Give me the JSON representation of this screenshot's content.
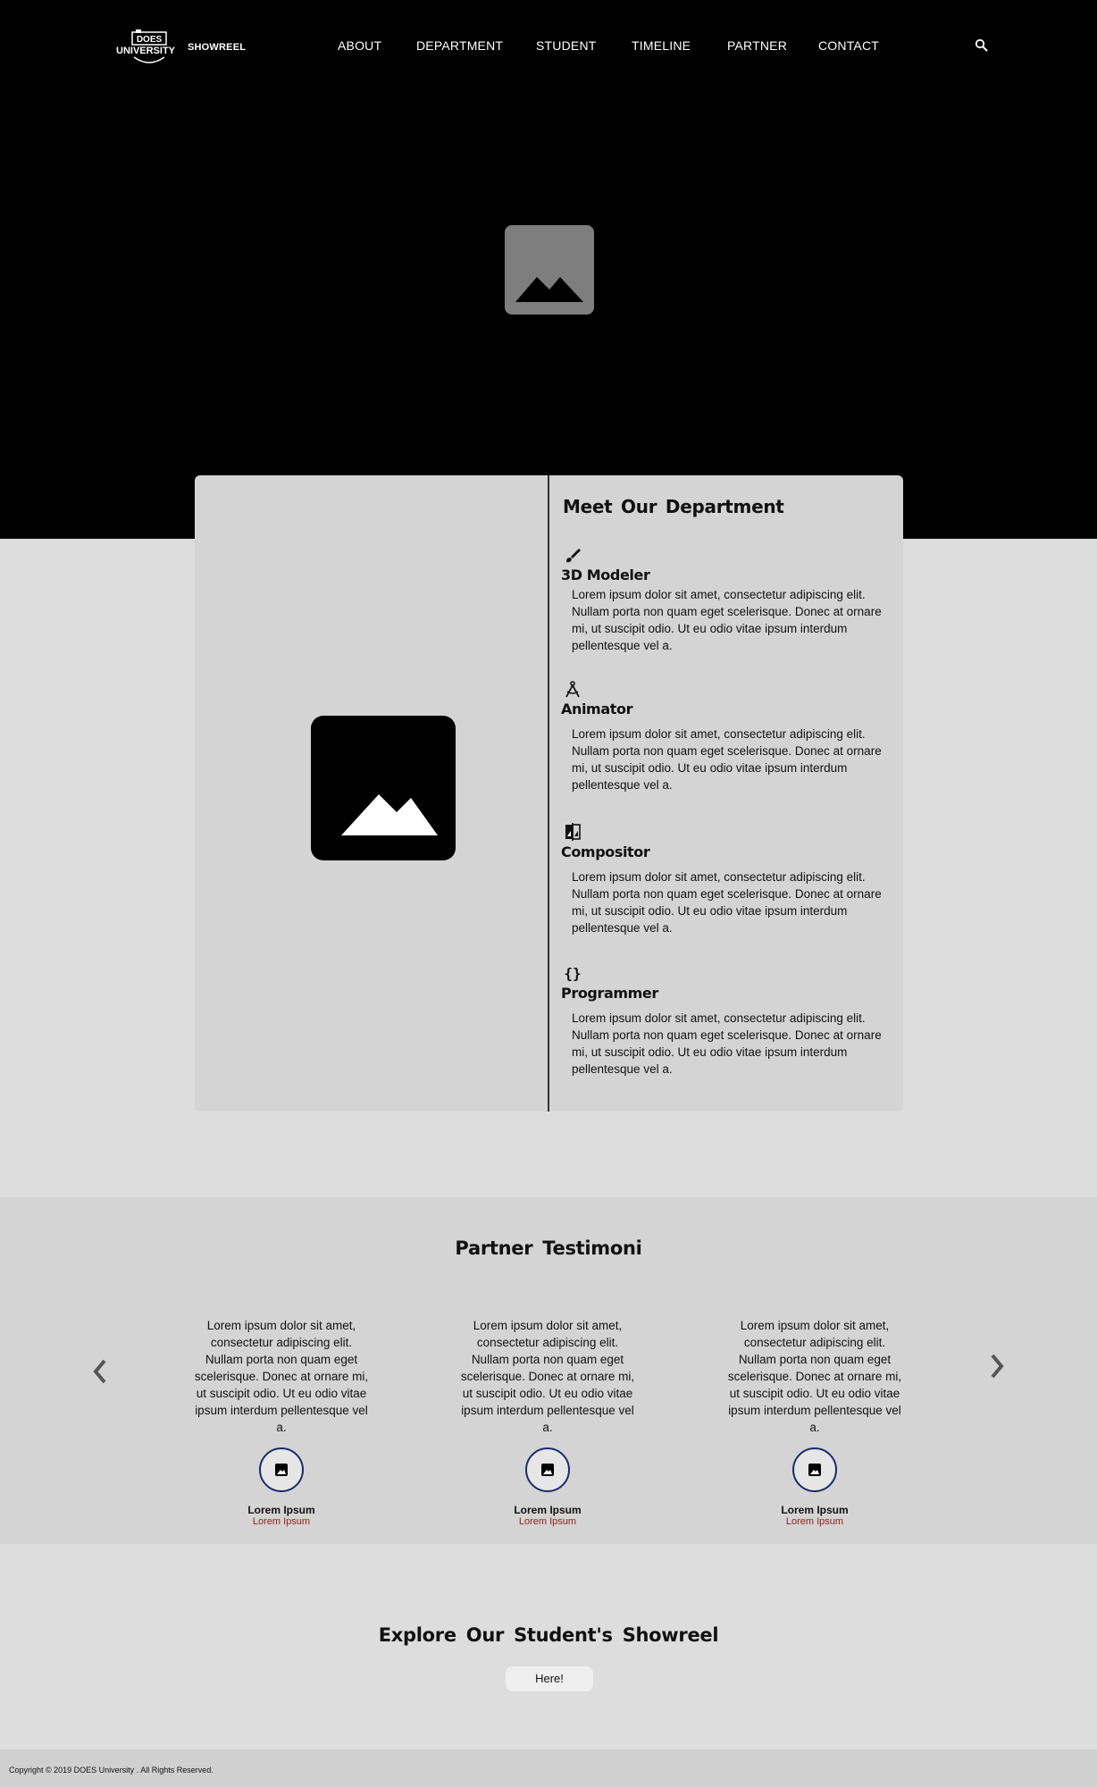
{
  "header": {
    "logo_word": "SHOWREEL",
    "logo_lettering": "DOES UNIVERSITY",
    "nav": [
      "ABOUT",
      "DEPARTMENT",
      "STUDENT",
      "TIMELINE",
      "PARTNER",
      "CONTACT"
    ],
    "search_icon": "search-icon"
  },
  "department": {
    "title": "Meet Our Department",
    "roles": [
      {
        "icon": "brush-icon",
        "name": "3D Modeler",
        "desc": "Lorem ipsum dolor sit amet, consectetur adipiscing elit. Nullam porta non quam eget scelerisque. Donec at ornare mi, ut suscipit odio. Ut eu odio vitae ipsum interdum pellentesque vel a."
      },
      {
        "icon": "compass-icon",
        "name": "Animator",
        "desc": "Lorem ipsum dolor sit amet, consectetur adipiscing elit. Nullam porta non quam eget scelerisque. Donec at ornare mi, ut suscipit odio. Ut eu odio vitae ipsum interdum pellentesque vel a."
      },
      {
        "icon": "compare-icon",
        "name": "Compositor",
        "desc": "Lorem ipsum dolor sit amet, consectetur adipiscing elit. Nullam porta non quam eget scelerisque. Donec at ornare mi, ut suscipit odio. Ut eu odio vitae ipsum interdum pellentesque vel a."
      },
      {
        "icon": "code-braces-icon",
        "name": "Programmer",
        "desc": "Lorem ipsum dolor sit amet, consectetur adipiscing elit. Nullam porta non quam eget scelerisque. Donec at ornare mi, ut suscipit odio. Ut eu odio vitae ipsum interdum pellentesque vel a."
      }
    ]
  },
  "testimonials": {
    "title": "Partner Testimoni",
    "items": [
      {
        "quote": "Lorem ipsum dolor sit amet, consectetur adipiscing elit. Nullam porta non quam eget scelerisque. Donec at ornare mi, ut suscipit odio. Ut eu odio vitae ipsum interdum pellentesque vel a.",
        "name": "Lorem Ipsum",
        "role": "Lorem Ipsum"
      },
      {
        "quote": "Lorem ipsum dolor sit amet, consectetur adipiscing elit. Nullam porta non quam eget scelerisque. Donec at ornare mi, ut suscipit odio. Ut eu odio vitae ipsum interdum pellentesque vel a.",
        "name": "Lorem Ipsum",
        "role": "Lorem Ipsum"
      },
      {
        "quote": "Lorem ipsum dolor sit amet, consectetur adipiscing elit. Nullam porta non quam eget scelerisque. Donec at ornare mi, ut suscipit odio. Ut eu odio vitae ipsum interdum pellentesque vel a.",
        "name": "Lorem Ipsum",
        "role": "Lorem Ipsum"
      }
    ]
  },
  "showreel": {
    "title": "Explore Our Student's Showreel",
    "button": "Here!"
  },
  "footer": {
    "copyright": "Copyright © 2019 DOES University . All Rights Reserved."
  },
  "colors": {
    "hero_bg": "#000000",
    "page_bg": "#dddddd",
    "card_bg": "#d4d4d4",
    "avatar_border": "#1a2a6c",
    "role_text": "#9a1a1a"
  }
}
